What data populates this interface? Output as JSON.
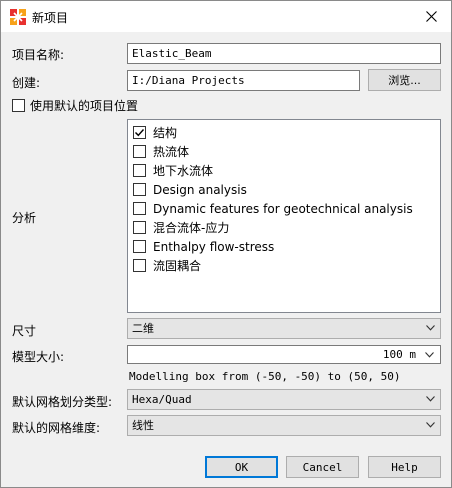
{
  "window": {
    "title": "新项目",
    "close_icon": "close-icon",
    "app_icon": "app-logo-icon"
  },
  "form": {
    "name_label": "项目名称:",
    "name_value": "Elastic_Beam",
    "create_label": "创建:",
    "create_value": "I:/Diana Projects",
    "browse_label": "浏览...",
    "default_location_label": "使用默认的项目位置",
    "default_location_checked": false,
    "analysis_label": "分析",
    "size_label": "尺寸",
    "size_value": "二维",
    "model_size_label": "模型大小:",
    "model_size_value": "100 m",
    "model_box_hint": "Modelling box from (-50, -50) to (50, 50)",
    "mesh_type_label": "默认网格划分类型:",
    "mesh_type_value": "Hexa/Quad",
    "mesh_dim_label": "默认的网格维度:",
    "mesh_dim_value": "线性"
  },
  "analysis_options": [
    {
      "label": "结构",
      "checked": true
    },
    {
      "label": "热流体",
      "checked": false
    },
    {
      "label": "地下水流体",
      "checked": false
    },
    {
      "label": "Design analysis",
      "checked": false
    },
    {
      "label": "Dynamic features for geotechnical analysis",
      "checked": false
    },
    {
      "label": "混合流体-应力",
      "checked": false
    },
    {
      "label": "Enthalpy flow-stress",
      "checked": false
    },
    {
      "label": "流固耦合",
      "checked": false
    }
  ],
  "buttons": {
    "ok": "OK",
    "cancel": "Cancel",
    "help": "Help"
  },
  "colors": {
    "accent": "#0078d7",
    "window_bg": "#f0f0f0"
  }
}
